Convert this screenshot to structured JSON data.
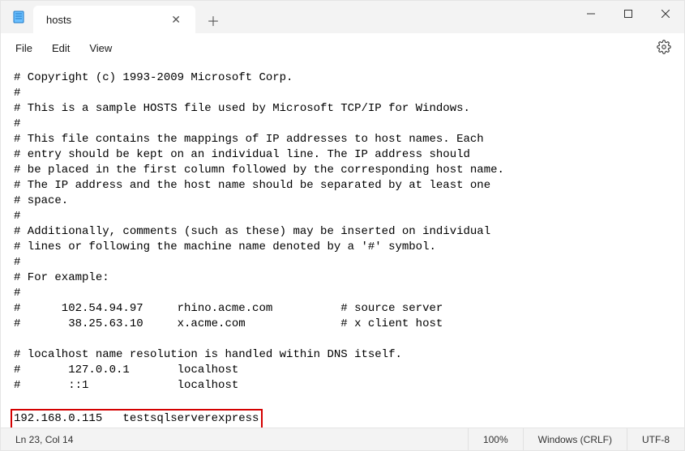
{
  "tab": {
    "title": "hosts"
  },
  "menu": {
    "file": "File",
    "edit": "Edit",
    "view": "View"
  },
  "editor": {
    "lines": [
      "# Copyright (c) 1993-2009 Microsoft Corp.",
      "#",
      "# This is a sample HOSTS file used by Microsoft TCP/IP for Windows.",
      "#",
      "# This file contains the mappings of IP addresses to host names. Each",
      "# entry should be kept on an individual line. The IP address should",
      "# be placed in the first column followed by the corresponding host name.",
      "# The IP address and the host name should be separated by at least one",
      "# space.",
      "#",
      "# Additionally, comments (such as these) may be inserted on individual",
      "# lines or following the machine name denoted by a '#' symbol.",
      "#",
      "# For example:",
      "#",
      "#      102.54.94.97     rhino.acme.com          # source server",
      "#       38.25.63.10     x.acme.com              # x client host",
      "",
      "# localhost name resolution is handled within DNS itself.",
      "#\t127.0.0.1       localhost",
      "#\t::1             localhost",
      ""
    ],
    "highlighted_line": "192.168.0.115\ttestsqlserverexpress"
  },
  "status": {
    "position": "Ln 23, Col 14",
    "zoom": "100%",
    "line_ending": "Windows (CRLF)",
    "encoding": "UTF-8"
  }
}
